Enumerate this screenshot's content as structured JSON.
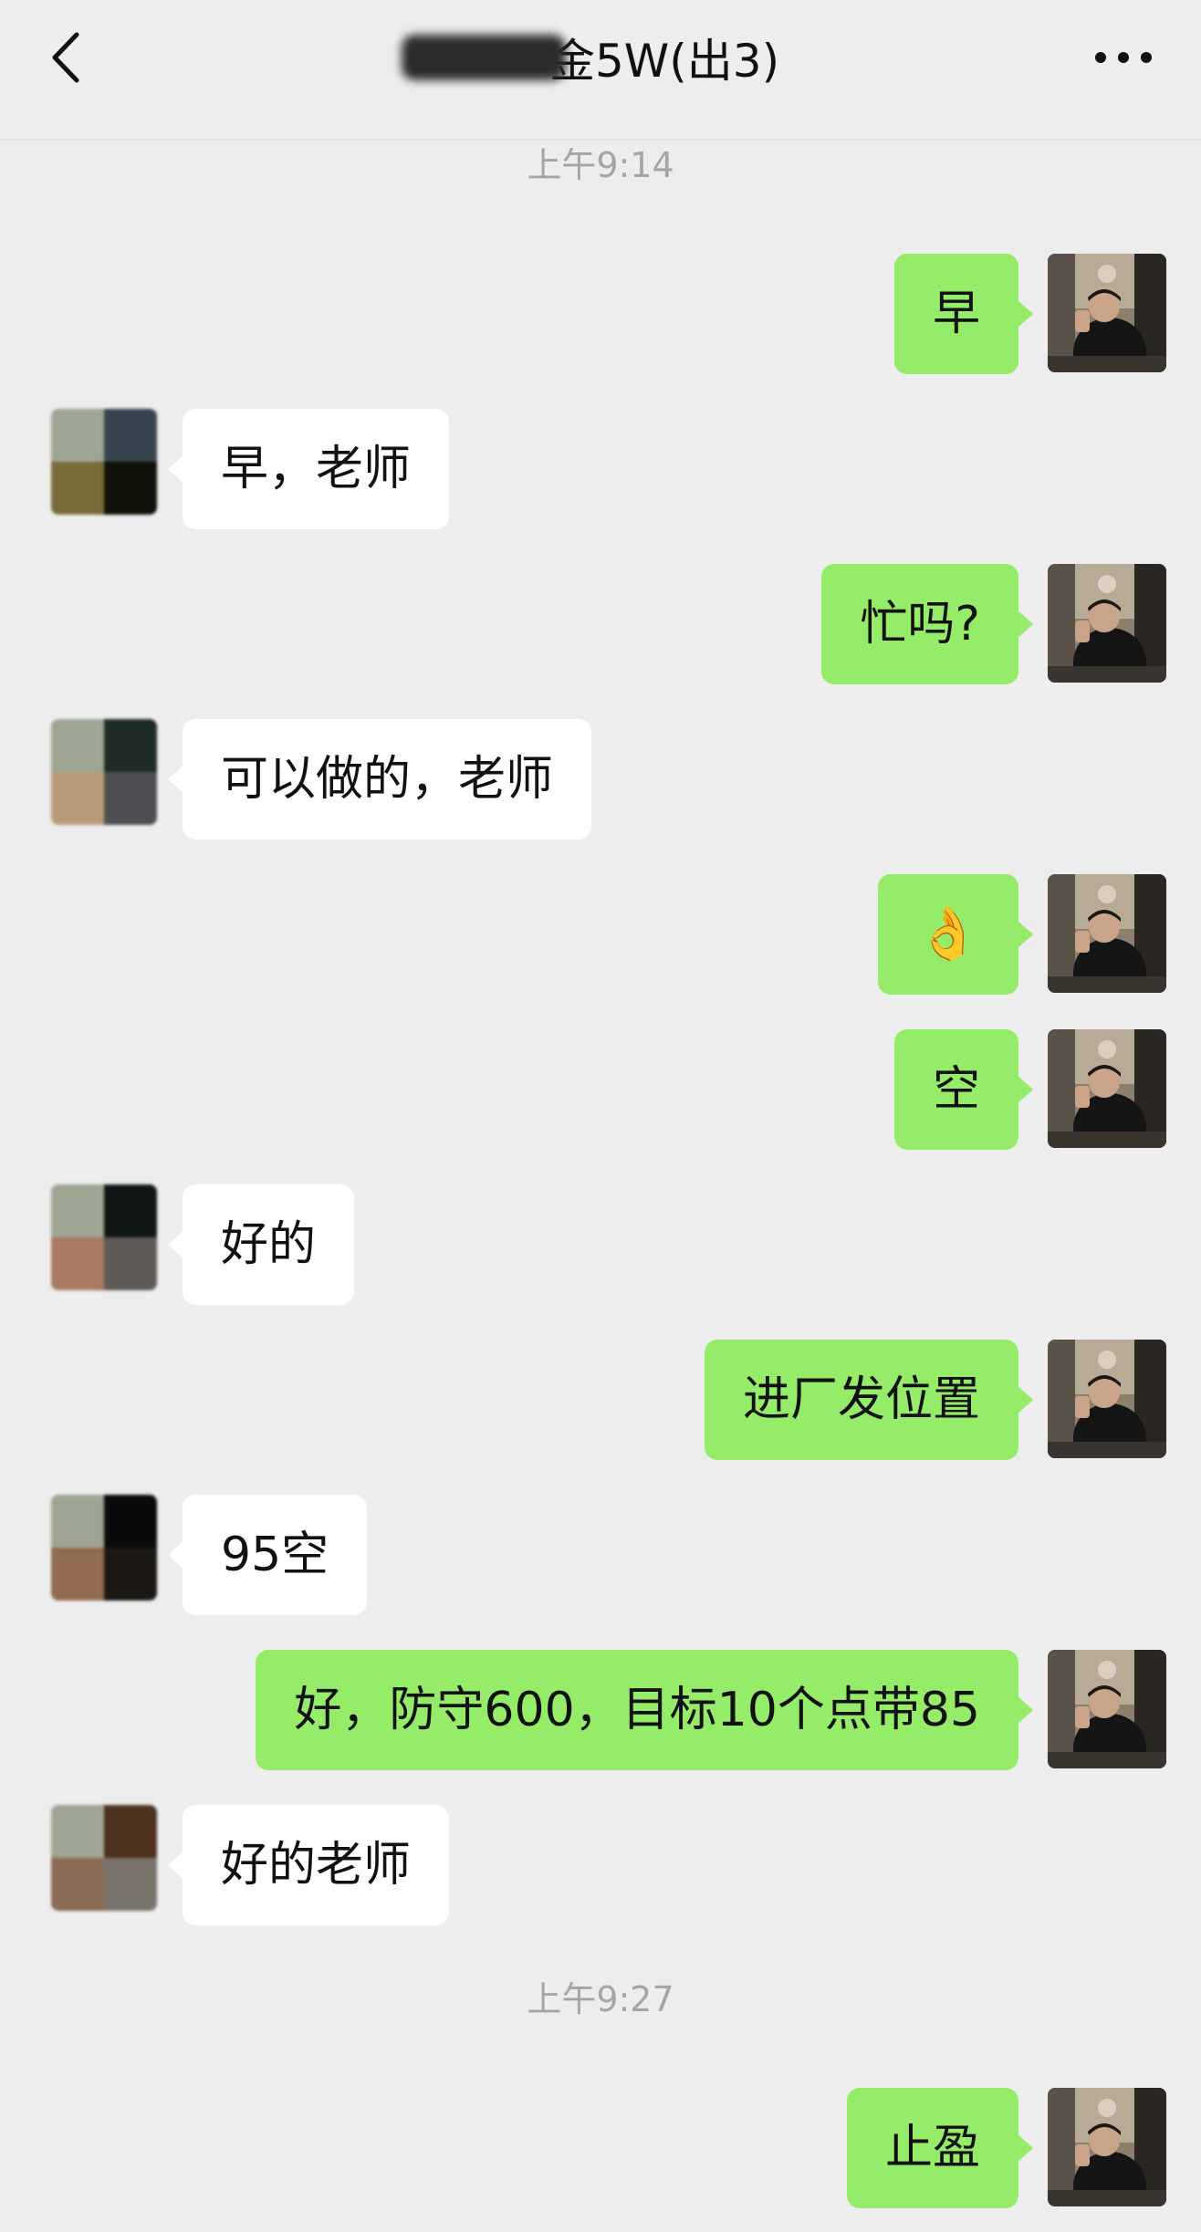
{
  "header": {
    "title": "金5W(出3)",
    "back_icon": "chevron-left-icon",
    "more_icon": "ellipsis-icon"
  },
  "colors": {
    "background": "#ededed",
    "self_bubble": "#95ec69",
    "other_bubble": "#ffffff",
    "timestamp": "#a5a5a5"
  },
  "timestamps": [
    "上午9:14",
    "上午9:27"
  ],
  "messages": [
    {
      "sender": "self",
      "text": "早"
    },
    {
      "sender": "other",
      "text": "早，老师"
    },
    {
      "sender": "self",
      "text": "忙吗?"
    },
    {
      "sender": "other",
      "text": "可以做的，老师"
    },
    {
      "sender": "self",
      "text": "👌"
    },
    {
      "sender": "self",
      "text": "空"
    },
    {
      "sender": "other",
      "text": "好的"
    },
    {
      "sender": "self",
      "text": "进厂发位置"
    },
    {
      "sender": "other",
      "text": "95空"
    },
    {
      "sender": "self",
      "text": "好，防守600，目标10个点带85"
    },
    {
      "sender": "other",
      "text": "好的老师"
    },
    {
      "sender": "self",
      "text": "止盈"
    }
  ],
  "avatars": {
    "other_tiles": [
      [
        "#9ea693",
        "#35444e",
        "#7a6c3a",
        "#111109"
      ],
      [
        "#9ea693",
        "#1e2b24",
        "#b99a78",
        "#4e4f52"
      ],
      [
        "#9ea693",
        "#101714",
        "#a87a62",
        "#5e5a55"
      ],
      [
        "#9ea693",
        "#0a0a0a",
        "#936b4f",
        "#1a1714"
      ],
      [
        "#9ea693",
        "#4e3220",
        "#8a6a55",
        "#79736b"
      ]
    ]
  }
}
